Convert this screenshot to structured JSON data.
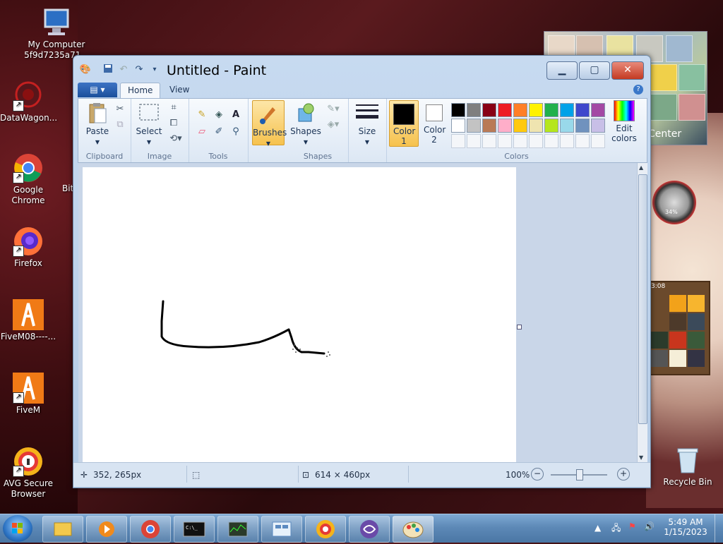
{
  "desktop": {
    "icons": [
      {
        "label": "My Computer 5f9d7235a71...",
        "icon": "computer-icon"
      },
      {
        "label": "DataWagon...",
        "icon": "datawagon-icon"
      },
      {
        "label": "Google Chrome",
        "icon": "chrome-icon"
      },
      {
        "label": "Firefox",
        "icon": "firefox-icon"
      },
      {
        "label": "FiveM08----...",
        "icon": "fivem-icon"
      },
      {
        "label": "FiveM",
        "icon": "fivem-icon"
      },
      {
        "label": "AVG Secure Browser",
        "icon": "avg-browser-icon"
      },
      {
        "label": "Recycle Bin",
        "icon": "recycle-bin-icon"
      },
      {
        "label": "Bit",
        "icon": "partial-icon"
      }
    ],
    "gadget_caption": "Center",
    "gauge_value": "34%",
    "puzzle_time": "3:08"
  },
  "window": {
    "title": "Untitled - Paint",
    "tabs": [
      {
        "label": "Home"
      },
      {
        "label": "View"
      }
    ],
    "groups": {
      "clipboard": {
        "label": "Clipboard",
        "paste": "Paste"
      },
      "image": {
        "label": "Image",
        "select": "Select"
      },
      "tools": {
        "label": "Tools"
      },
      "brushes": {
        "label": "Brushes"
      },
      "shapes": {
        "label": "Shapes",
        "shapes_btn": "Shapes"
      },
      "size": {
        "label": "Size"
      },
      "colors": {
        "label": "Colors",
        "color1": "Color 1",
        "color2": "Color 2",
        "edit": "Edit colors",
        "color1_value": "#000000",
        "color2_value": "#ffffff",
        "palette_row1": [
          "#000000",
          "#7f7f7f",
          "#880015",
          "#ed1c24",
          "#ff7f27",
          "#fff200",
          "#22b14c",
          "#00a2e8",
          "#3f48cc",
          "#a349a4"
        ],
        "palette_row2": [
          "#ffffff",
          "#c3c3c3",
          "#b97a57",
          "#ffaec9",
          "#ffc90e",
          "#efe4b0",
          "#b5e61d",
          "#99d9ea",
          "#7092be",
          "#c8bfe7"
        ]
      }
    },
    "status": {
      "cursor_pos": "352, 265px",
      "canvas_size": "614 × 460px",
      "zoom": "100%"
    }
  },
  "taskbar": {
    "time": "5:49 AM",
    "date": "1/15/2023",
    "items": [
      "explorer",
      "media-player",
      "chrome",
      "cmd",
      "task-manager",
      "control-panel",
      "avg-browser",
      "torrent",
      "paint"
    ]
  }
}
